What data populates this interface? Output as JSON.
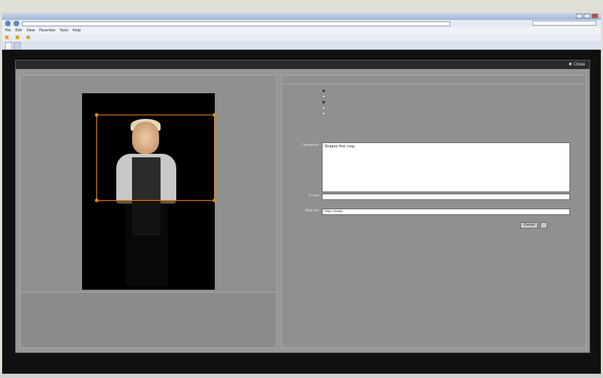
{
  "browser": {
    "title": "",
    "url": "",
    "search_placeholder": "",
    "menus": [
      "File",
      "Edit",
      "View",
      "Favorites",
      "Tools",
      "Help"
    ],
    "tabs": [
      {
        "label": ""
      },
      {
        "label": ""
      }
    ]
  },
  "modal": {
    "title": "",
    "close_label": "Close"
  },
  "left": {
    "caption": "",
    "selection_count": "",
    "footnote": ""
  },
  "right": {
    "header": "",
    "options": [
      {
        "label": "",
        "selected": true
      },
      {
        "label": "",
        "selected": false
      },
      {
        "label": "",
        "selected": true
      },
      {
        "label": "",
        "selected": false
      },
      {
        "label": "",
        "selected": false
      }
    ],
    "note": "",
    "comments_label": "Comments",
    "comments_value": "Shapes fine crop",
    "email_label": "E-mail",
    "email_value": "",
    "hint": "",
    "website_label": "Web site",
    "website_value": "http://www.",
    "cancel_label": "Cancel",
    "submit_label": ""
  },
  "colors": {
    "crop_frame": "#e5891c"
  }
}
